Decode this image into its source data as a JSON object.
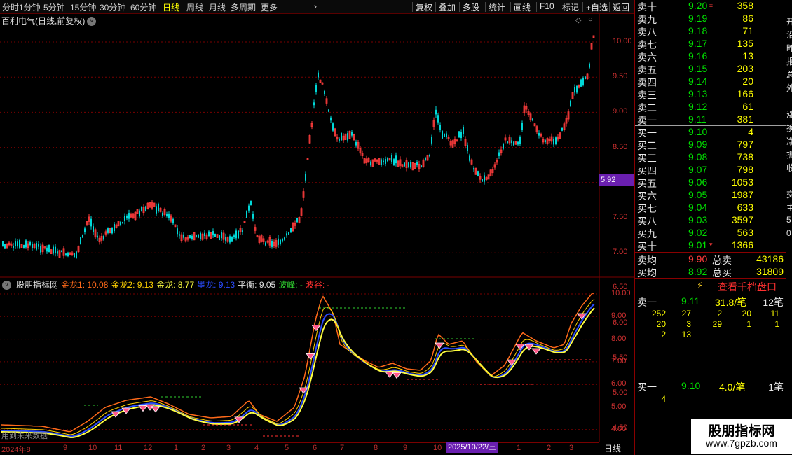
{
  "toolbar": {
    "periods": [
      {
        "label": "分时",
        "active": false
      },
      {
        "label": "1分钟",
        "active": false
      },
      {
        "label": "5分钟",
        "active": false
      },
      {
        "label": "15分钟",
        "active": false
      },
      {
        "label": "30分钟",
        "active": false
      },
      {
        "label": "60分钟",
        "active": false
      },
      {
        "label": "日线",
        "active": true
      },
      {
        "label": "周线",
        "active": false
      },
      {
        "label": "月线",
        "active": false
      },
      {
        "label": "多周期",
        "active": false
      },
      {
        "label": "更多",
        "active": false
      }
    ],
    "more_arrow": "›",
    "tools": [
      "复权",
      "叠加",
      "多股",
      "统计",
      "画线",
      "F10",
      "标记",
      "+自选",
      "返回"
    ]
  },
  "main_chart": {
    "title": "百利电气(日线,前复权)",
    "y_labels": [
      "10.00",
      "9.50",
      "9.00",
      "8.50",
      "8.00",
      "7.50",
      "7.00",
      "6.50",
      "6.00",
      "5.50",
      "5.00",
      "4.50",
      "4.00"
    ],
    "current_price_tag": "5.92"
  },
  "indicator": {
    "name": "股朋指标网",
    "items": [
      {
        "label": "金龙1: 10.08",
        "color": "#ff6a1a"
      },
      {
        "label": "金龙2: 9.13",
        "color": "#ffd000"
      },
      {
        "label": "金龙: 8.77",
        "color": "#ffff40"
      },
      {
        "label": "墨龙: 9.13",
        "color": "#2a4cff"
      },
      {
        "label": "平衡: 9.05",
        "color": "#e0e0e0"
      },
      {
        "label": "波峰: -",
        "color": "#30d030"
      },
      {
        "label": "波谷: -",
        "color": "#ff3030"
      }
    ],
    "y_labels": [
      "10.00",
      "9.00",
      "8.00",
      "7.00",
      "6.00",
      "5.00",
      "4.00"
    ],
    "future_data_label": "用到未来数据"
  },
  "x_axis": {
    "labels": [
      "2024年8",
      "9",
      "10",
      "11",
      "12",
      "1",
      "2",
      "3",
      "4",
      "5",
      "6",
      "7",
      "8",
      "9",
      "10",
      "1",
      "2",
      "3"
    ],
    "date_tag": "2025/10/22/三",
    "daily_tab": "日线"
  },
  "order_book": {
    "asks": [
      {
        "label": "卖十",
        "price": "9.20",
        "vol": "358",
        "mark": "±"
      },
      {
        "label": "卖九",
        "price": "9.19",
        "vol": "86",
        "mark": ""
      },
      {
        "label": "卖八",
        "price": "9.18",
        "vol": "71",
        "mark": ""
      },
      {
        "label": "卖七",
        "price": "9.17",
        "vol": "135",
        "mark": ""
      },
      {
        "label": "卖六",
        "price": "9.16",
        "vol": "13",
        "mark": ""
      },
      {
        "label": "卖五",
        "price": "9.15",
        "vol": "203",
        "mark": ""
      },
      {
        "label": "卖四",
        "price": "9.14",
        "vol": "20",
        "mark": ""
      },
      {
        "label": "卖三",
        "price": "9.13",
        "vol": "166",
        "mark": ""
      },
      {
        "label": "卖二",
        "price": "9.12",
        "vol": "61",
        "mark": ""
      },
      {
        "label": "卖一",
        "price": "9.11",
        "vol": "381",
        "mark": ""
      }
    ],
    "bids": [
      {
        "label": "买一",
        "price": "9.10",
        "vol": "4",
        "mark": ""
      },
      {
        "label": "买二",
        "price": "9.09",
        "vol": "797",
        "mark": ""
      },
      {
        "label": "买三",
        "price": "9.08",
        "vol": "738",
        "mark": ""
      },
      {
        "label": "买四",
        "price": "9.07",
        "vol": "798",
        "mark": ""
      },
      {
        "label": "买五",
        "price": "9.06",
        "vol": "1053",
        "mark": ""
      },
      {
        "label": "买六",
        "price": "9.05",
        "vol": "1987",
        "mark": ""
      },
      {
        "label": "买七",
        "price": "9.04",
        "vol": "633",
        "mark": ""
      },
      {
        "label": "买八",
        "price": "9.03",
        "vol": "3597",
        "mark": ""
      },
      {
        "label": "买九",
        "price": "9.02",
        "vol": "563",
        "mark": ""
      },
      {
        "label": "买十",
        "price": "9.01",
        "vol": "1366",
        "mark": "▾"
      }
    ],
    "summary": {
      "ask_avg_label": "卖均",
      "ask_avg": "9.90",
      "total_ask_label": "总卖",
      "total_ask": "43186",
      "bid_avg_label": "买均",
      "bid_avg": "8.92",
      "total_bid_label": "总买",
      "total_bid": "31809"
    }
  },
  "thousand_panel": {
    "button_label": "查看千档盘口",
    "ask_row": {
      "label": "卖一",
      "price": "9.11",
      "size": "31.8/笔",
      "count": "12笔"
    },
    "ask_queue": [
      [
        "252",
        "27",
        "2",
        "20",
        "11"
      ],
      [
        "20",
        "3",
        "29",
        "1",
        "1"
      ],
      [
        "2",
        "13"
      ]
    ],
    "bid_row": {
      "label": "买一",
      "price": "9.10",
      "size": "4.0/笔",
      "count": "1笔"
    },
    "bid_queue": [
      [
        "4"
      ]
    ]
  },
  "edge_chars": [
    "开",
    "沿",
    "昨",
    "报",
    "总",
    "外",
    "",
    "涨",
    "换",
    "净",
    "振",
    "收",
    "",
    "交",
    "主",
    "5",
    "0"
  ],
  "watermark": {
    "title": "股朋指标网",
    "url": "www.7gpzb.com"
  },
  "colors": {
    "up": "#ff3c3c",
    "down": "#00d8d8",
    "grid": "#7a0000",
    "accent": "#6a1fb0"
  }
}
